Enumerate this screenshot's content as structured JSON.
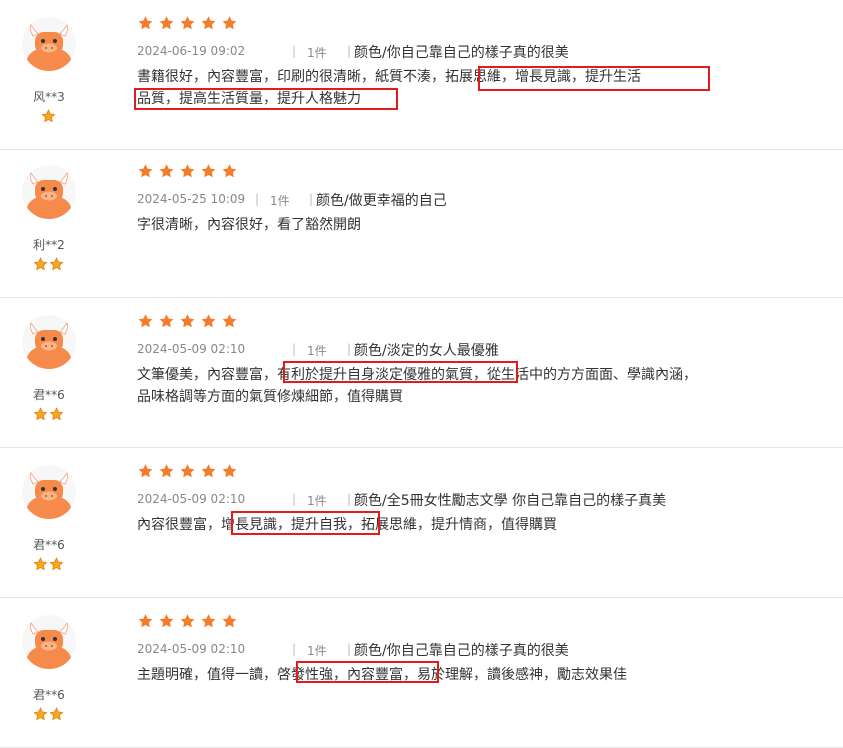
{
  "colors": {
    "star": "#f57c2a",
    "avatar_face": "#f58a4a",
    "highlight": "#e21b1b",
    "badge": "#f5a623"
  },
  "reviews": [
    {
      "user": "风**3",
      "badge_count": 1,
      "rating": 5,
      "date": "2024-06-19 09:02",
      "qty": "1件",
      "option": "颜色/你自己靠自己的樣子真的很美",
      "line1": "書籍很好，內容豐富，印刷的很清晰，紙質不湊，拓展思維，增長見識，提升生活",
      "line2": "品質，提高生活質量，提升人格魅力"
    },
    {
      "user": "利**2",
      "badge_count": 2,
      "rating": 5,
      "date": "2024-05-25 10:09",
      "qty": "1件",
      "option": "颜色/做更幸福的自己",
      "line1": "字很清晰，內容很好，看了豁然開朗",
      "line2": ""
    },
    {
      "user": "君**6",
      "badge_count": 2,
      "rating": 5,
      "date": "2024-05-09 02:10",
      "qty": "1件",
      "option": "颜色/淡定的女人最優雅",
      "line1": "文筆優美，內容豐富，有利於提升自身淡定優雅的氣質，從生活中的方方面面、學識內涵，",
      "line2": "品味格調等方面的氣質修煉細節，值得購買"
    },
    {
      "user": "君**6",
      "badge_count": 2,
      "rating": 5,
      "date": "2024-05-09 02:10",
      "qty": "1件",
      "option": "颜色/全5冊女性勵志文學 你自己靠自己的樣子真美",
      "line1": "內容很豐富，增長見識，提升自我，拓展思維，提升情商，值得購買",
      "line2": ""
    },
    {
      "user": "君**6",
      "badge_count": 2,
      "rating": 5,
      "date": "2024-05-09 02:10",
      "qty": "1件",
      "option": "颜色/你自己靠自己的樣子真的很美",
      "line1": "主題明確，值得一讀，啓發性強，內容豐富，易於理解，讀後感神，勵志效果佳",
      "line2": ""
    }
  ]
}
